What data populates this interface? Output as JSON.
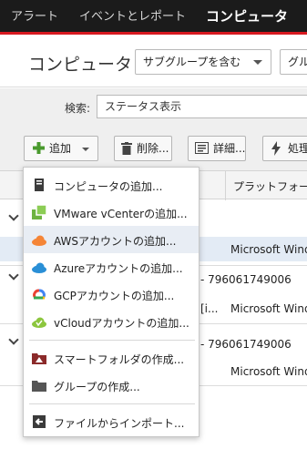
{
  "nav": {
    "tabs": [
      {
        "label": "アラート"
      },
      {
        "label": "イベントとレポート"
      },
      {
        "label": "コンピュータ"
      }
    ]
  },
  "header": {
    "title": "コンピュータ",
    "group_filter": "サブグループを含む",
    "group_filter2": "グル"
  },
  "search": {
    "label": "検索:",
    "value": "ステータス表示"
  },
  "toolbar": {
    "add": "追加",
    "delete": "削除...",
    "details": "詳細...",
    "process": "処理"
  },
  "table": {
    "platform_header": "プラットフォー",
    "rows": [
      {
        "platform": "Microsoft Windo"
      },
      {
        "name_suffix": "- 796061749006"
      },
      {
        "extra": "[i...",
        "platform": "Microsoft Windo"
      },
      {
        "name_suffix": "- 796061749006"
      },
      {
        "platform": "Microsoft Windo"
      }
    ]
  },
  "menu": {
    "items": [
      {
        "label": "コンピュータの追加...",
        "icon": "computer-icon"
      },
      {
        "label": "VMware vCenterの追加...",
        "icon": "vmware-icon"
      },
      {
        "label": "AWSアカウントの追加...",
        "icon": "aws-cloud-icon"
      },
      {
        "label": "Azureアカウントの追加...",
        "icon": "azure-cloud-icon"
      },
      {
        "label": "GCPアカウントの追加...",
        "icon": "gcp-icon"
      },
      {
        "label": "vCloudアカウントの追加...",
        "icon": "vcloud-icon"
      },
      {
        "label": "スマートフォルダの作成...",
        "icon": "smart-folder-icon"
      },
      {
        "label": "グループの作成...",
        "icon": "folder-icon"
      },
      {
        "label": "ファイルからインポート...",
        "icon": "import-icon"
      }
    ]
  },
  "colors": {
    "nav_bg": "#1b1b1b",
    "nav_accent": "#d71920",
    "aws": "#f58536",
    "azure": "#2a8fd6",
    "vmware": "#6db33f",
    "hover": "#e8edf4"
  }
}
